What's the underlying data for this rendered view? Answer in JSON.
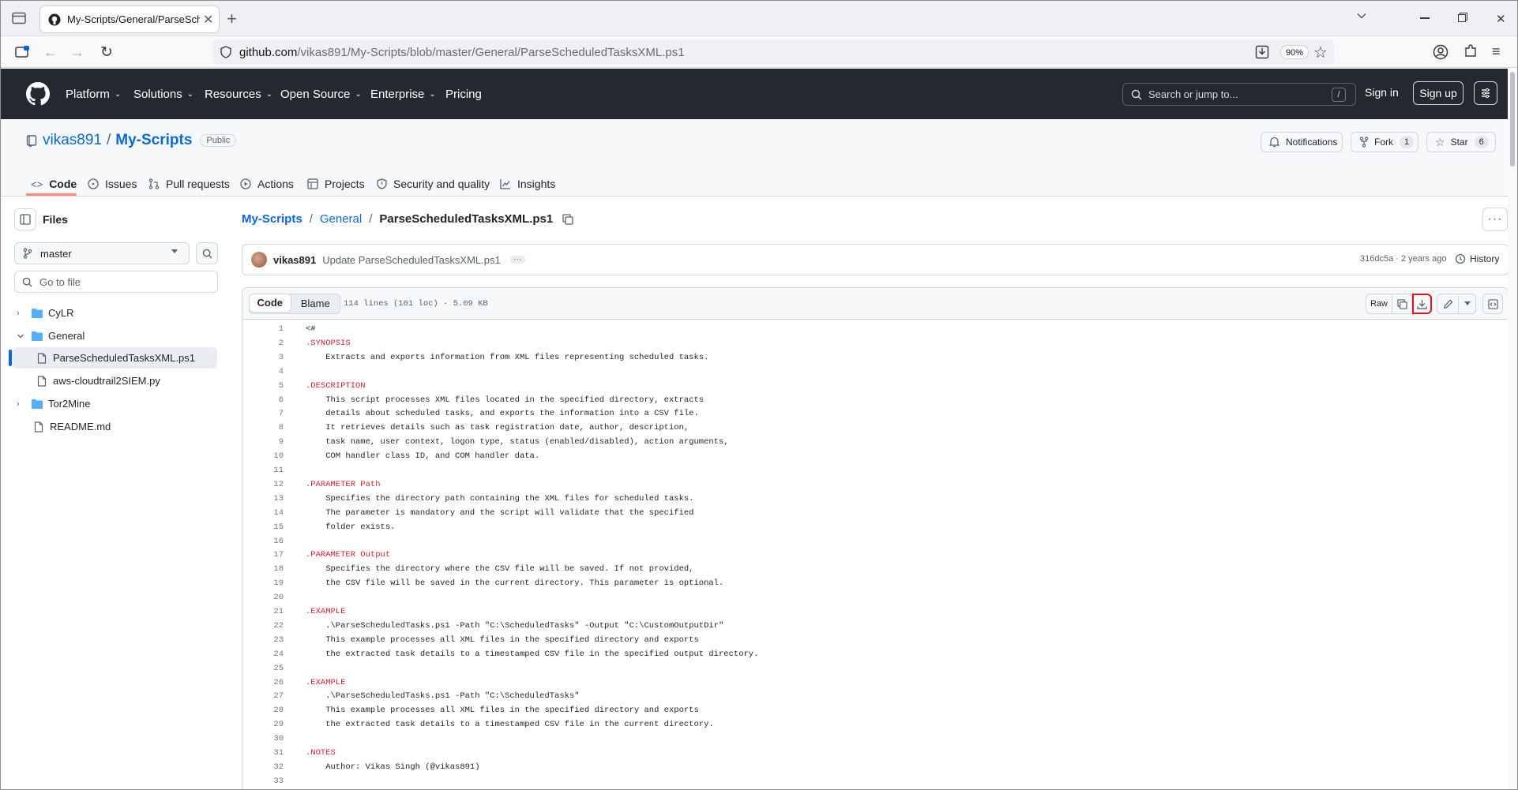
{
  "browser": {
    "tab_title": "My-Scripts/General/ParseSched",
    "new_tab_label": "+",
    "url_domain": "github.com",
    "url_path": "/vikas891/My-Scripts/blob/master/General/ParseScheduledTasksXML.ps1",
    "zoom": "90%"
  },
  "header": {
    "nav": [
      "Platform",
      "Solutions",
      "Resources",
      "Open Source",
      "Enterprise",
      "Pricing"
    ],
    "search_placeholder": "Search or jump to...",
    "search_shortcut": "/",
    "signin": "Sign in",
    "signup": "Sign up"
  },
  "repo": {
    "owner": "vikas891",
    "sep": "/",
    "name": "My-Scripts",
    "visibility": "Public",
    "notifications": "Notifications",
    "fork": "Fork",
    "fork_count": "1",
    "star": "Star",
    "star_count": "6",
    "tabs": [
      "Code",
      "Issues",
      "Pull requests",
      "Actions",
      "Projects",
      "Security and quality",
      "Insights"
    ]
  },
  "sidebar": {
    "title": "Files",
    "branch": "master",
    "goto_placeholder": "Go to file",
    "tree": [
      {
        "name": "CyLR",
        "type": "folder",
        "expanded": false
      },
      {
        "name": "General",
        "type": "folder",
        "expanded": true
      },
      {
        "name": "ParseScheduledTasksXML.ps1",
        "type": "file",
        "selected": true
      },
      {
        "name": "aws-cloudtrail2SIEM.py",
        "type": "file"
      },
      {
        "name": "Tor2Mine",
        "type": "folder",
        "expanded": false
      },
      {
        "name": "README.md",
        "type": "file"
      }
    ]
  },
  "file": {
    "breadcrumb": [
      "My-Scripts",
      "General",
      "ParseScheduledTasksXML.ps1"
    ],
    "commit_author": "vikas891",
    "commit_message": "Update ParseScheduledTasksXML.ps1",
    "commit_meta": "316dc5a · 2 years ago",
    "history": "History",
    "view_code": "Code",
    "view_blame": "Blame",
    "info": "114 lines (101 loc) · 5.09 KB",
    "raw": "Raw"
  },
  "code_lines": [
    {
      "n": "1",
      "t": "<#"
    },
    {
      "n": "2",
      "t": ".SYNOPSIS",
      "kw": true
    },
    {
      "n": "3",
      "t": "    Extracts and exports information from XML files representing scheduled tasks."
    },
    {
      "n": "4",
      "t": ""
    },
    {
      "n": "5",
      "t": ".DESCRIPTION",
      "kw": true
    },
    {
      "n": "6",
      "t": "    This script processes XML files located in the specified directory, extracts"
    },
    {
      "n": "7",
      "t": "    details about scheduled tasks, and exports the information into a CSV file."
    },
    {
      "n": "8",
      "t": "    It retrieves details such as task registration date, author, description,"
    },
    {
      "n": "9",
      "t": "    task name, user context, logon type, status (enabled/disabled), action arguments,"
    },
    {
      "n": "10",
      "t": "    COM handler class ID, and COM handler data."
    },
    {
      "n": "11",
      "t": ""
    },
    {
      "n": "12",
      "t": ".PARAMETER Path",
      "kw": true
    },
    {
      "n": "13",
      "t": "    Specifies the directory path containing the XML files for scheduled tasks."
    },
    {
      "n": "14",
      "t": "    The parameter is mandatory and the script will validate that the specified"
    },
    {
      "n": "15",
      "t": "    folder exists."
    },
    {
      "n": "16",
      "t": ""
    },
    {
      "n": "17",
      "t": ".PARAMETER Output",
      "kw": true
    },
    {
      "n": "18",
      "t": "    Specifies the directory where the CSV file will be saved. If not provided,"
    },
    {
      "n": "19",
      "t": "    the CSV file will be saved in the current directory. This parameter is optional."
    },
    {
      "n": "20",
      "t": ""
    },
    {
      "n": "21",
      "t": ".EXAMPLE",
      "kw": true
    },
    {
      "n": "22",
      "t": "    .\\ParseScheduledTasks.ps1 -Path \"C:\\ScheduledTasks\" -Output \"C:\\CustomOutputDir\""
    },
    {
      "n": "23",
      "t": "    This example processes all XML files in the specified directory and exports"
    },
    {
      "n": "24",
      "t": "    the extracted task details to a timestamped CSV file in the specified output directory."
    },
    {
      "n": "25",
      "t": ""
    },
    {
      "n": "26",
      "t": ".EXAMPLE",
      "kw": true
    },
    {
      "n": "27",
      "t": "    .\\ParseScheduledTasks.ps1 -Path \"C:\\ScheduledTasks\""
    },
    {
      "n": "28",
      "t": "    This example processes all XML files in the specified directory and exports"
    },
    {
      "n": "29",
      "t": "    the extracted task details to a timestamped CSV file in the current directory."
    },
    {
      "n": "30",
      "t": ""
    },
    {
      "n": "31",
      "t": ".NOTES",
      "kw": true
    },
    {
      "n": "32",
      "t": "    Author: Vikas Singh (@vikas891)"
    },
    {
      "n": "33",
      "t": ""
    }
  ],
  "colors": {
    "accent": "#0969da",
    "header_bg": "#24292f",
    "highlight_box": "#e3121b",
    "keyword": "#cf222e",
    "selected_bar": "#0969da"
  }
}
